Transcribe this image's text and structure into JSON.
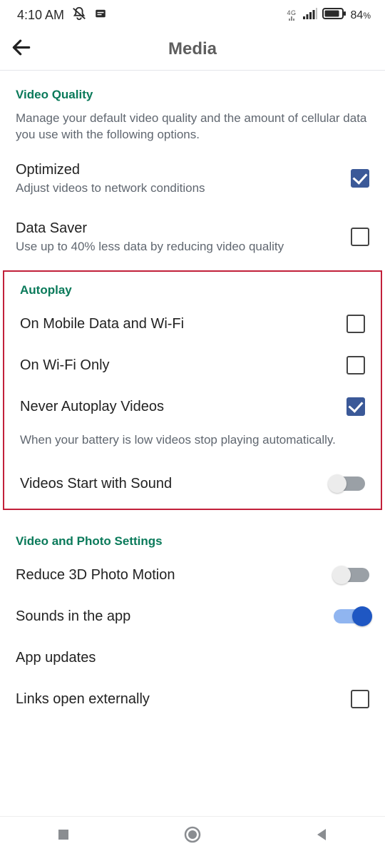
{
  "status": {
    "time": "4:10 AM",
    "network": "4G",
    "battery": "84",
    "battery_pct_sign": "%"
  },
  "header": {
    "title": "Media"
  },
  "video_quality": {
    "title": "Video Quality",
    "desc": "Manage your default video quality and the amount of cellular data you use with the following options.",
    "optimized": {
      "title": "Optimized",
      "sub": "Adjust videos to network conditions",
      "checked": true
    },
    "data_saver": {
      "title": "Data Saver",
      "sub": "Use up to 40% less data by reducing video quality",
      "checked": false
    }
  },
  "autoplay": {
    "title": "Autoplay",
    "mobile_wifi": {
      "title": "On Mobile Data and Wi-Fi",
      "checked": false
    },
    "wifi_only": {
      "title": "On Wi-Fi Only",
      "checked": false
    },
    "never": {
      "title": "Never Autoplay Videos",
      "checked": true
    },
    "note": "When your battery is low videos stop playing automatically.",
    "videos_sound": {
      "title": "Videos Start with Sound",
      "on": false
    }
  },
  "video_photo": {
    "title": "Video and Photo Settings",
    "reduce_3d": {
      "title": "Reduce 3D Photo Motion",
      "on": false
    },
    "sounds_app": {
      "title": "Sounds in the app",
      "on": true
    },
    "app_updates": {
      "title": "App updates"
    },
    "links_ext": {
      "title": "Links open externally",
      "checked": false
    }
  }
}
